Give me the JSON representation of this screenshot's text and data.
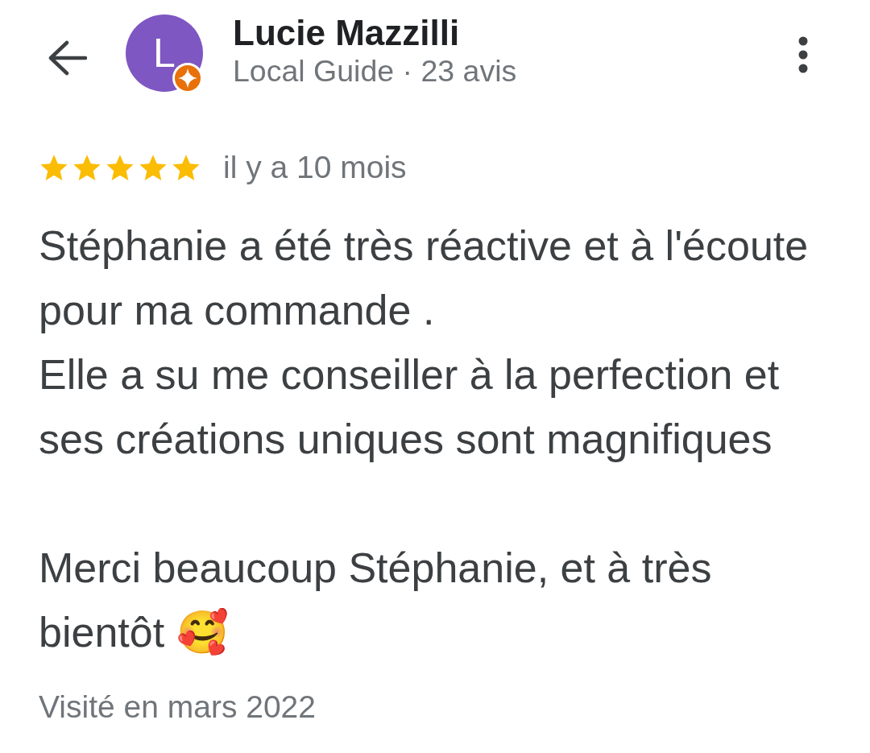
{
  "header": {
    "avatar_letter": "L",
    "reviewer_name": "Lucie Mazzilli",
    "subtitle": "Local Guide · 23 avis"
  },
  "review": {
    "stars": 5,
    "time": "il y a 10 mois",
    "text": "Stéphanie a été très réactive et à l'écoute\npour ma commande .\nElle a su me conseiller à la perfection et\nses créations uniques sont magnifiques\n\nMerci beaucoup Stéphanie, et à très\nbientôt 🥰",
    "visited": "Visité en mars 2022"
  }
}
